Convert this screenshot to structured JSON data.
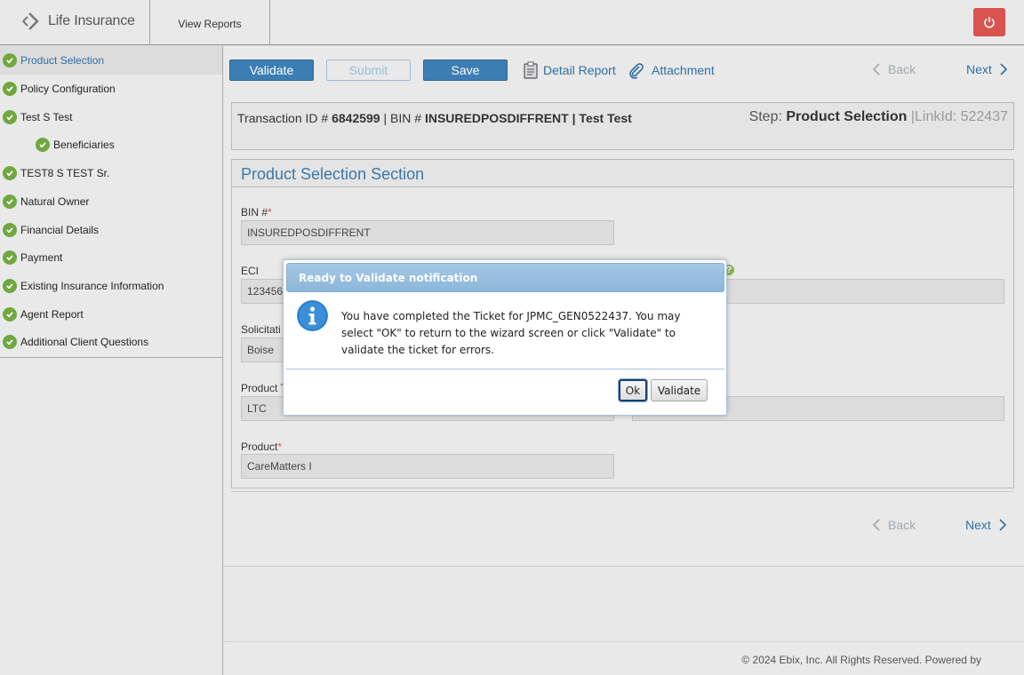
{
  "header": {
    "app_title": "Life Insurance",
    "view_reports": "View Reports",
    "power_icon": "power-icon"
  },
  "sidebar": {
    "items": [
      {
        "label": "Product Selection",
        "active": true
      },
      {
        "label": "Policy Configuration"
      },
      {
        "label": "Test S Test"
      },
      {
        "label": "Beneficiaries",
        "indent": true
      },
      {
        "label": "TEST8 S TEST Sr."
      },
      {
        "label": "Natural Owner"
      },
      {
        "label": "Financial Details"
      },
      {
        "label": "Payment"
      },
      {
        "label": "Existing Insurance Information"
      },
      {
        "label": "Agent Report"
      },
      {
        "label": "Additional Client Questions"
      }
    ]
  },
  "toolbar": {
    "validate": "Validate",
    "submit": "Submit",
    "save": "Save",
    "detail_report": "Detail Report",
    "attachment": "Attachment",
    "back": "Back",
    "next": "Next"
  },
  "transaction": {
    "id_label": "Transaction ID #",
    "id_value": "6842599",
    "bin_label": "| BIN #",
    "bin_value": "INSUREDPOSDIFFRENT",
    "name_value": "| Test Test",
    "step_label": "Step:",
    "step_value": "Product Selection",
    "link_label": "|LinkId: 522437"
  },
  "section": {
    "title": "Product Selection Section",
    "fields": {
      "bin_label": "BIN #",
      "bin_value": "INSUREDPOSDIFFRENT",
      "eci_label": "ECI",
      "eci_value": "123456",
      "solicitation_label": "Solicitati",
      "solicitation_value": "Boise",
      "product_type_label": "Product T",
      "product_type_value": "LTC",
      "product_label": "Product",
      "product_value": "CareMatters I",
      "required_mark": "*"
    }
  },
  "bottom_nav": {
    "back": "Back",
    "next": "Next"
  },
  "footer": {
    "text": "© 2024 Ebix, Inc. All Rights Reserved. Powered by"
  },
  "modal": {
    "title": "Ready to Validate notification",
    "message": "You have completed the Ticket for JPMC_GEN0522437. You may select \"OK\" to return to the wizard screen or click \"Validate\" to validate the ticket for errors.",
    "ok": "Ok",
    "validate": "Validate",
    "icon": "info-icon"
  },
  "colors": {
    "primary": "#3c7db3",
    "link": "#2f6fa3",
    "check": "#6fa83f",
    "danger": "#d9534f",
    "modal_title": "#8cb6da"
  }
}
